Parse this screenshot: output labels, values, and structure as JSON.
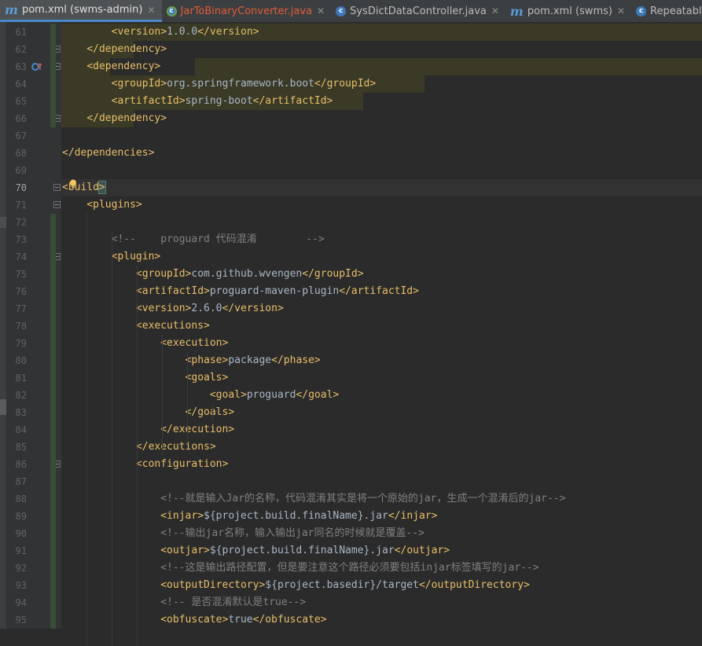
{
  "tabs": [
    {
      "icon": "maven-icon",
      "label": "pom.xml (swms-admin)",
      "active": true,
      "closable": true
    },
    {
      "icon": "java-class-icon",
      "label": "JarToBinaryConverter.java",
      "active": false,
      "closable": true,
      "error": true
    },
    {
      "icon": "java-class-icon",
      "label": "SysDictDataController.java",
      "active": false,
      "closable": true
    },
    {
      "icon": "maven-icon",
      "label": "pom.xml (swms)",
      "active": false,
      "closable": true
    },
    {
      "icon": "java-class-icon",
      "label": "RepeatableFilter.java",
      "active": false,
      "closable": false
    }
  ],
  "lines": [
    {
      "n": "61",
      "text": "        <version>1.0.0</version>"
    },
    {
      "n": "62",
      "text": "    </dependency>"
    },
    {
      "n": "63",
      "text": "    <dependency>"
    },
    {
      "n": "64",
      "text": "        <groupId>org.springframework.boot</groupId>"
    },
    {
      "n": "65",
      "text": "        <artifactId>spring-boot</artifactId>"
    },
    {
      "n": "66",
      "text": "    </dependency>"
    },
    {
      "n": "67",
      "text": ""
    },
    {
      "n": "68",
      "text": "</dependencies>"
    },
    {
      "n": "69",
      "text": ""
    },
    {
      "n": "70",
      "text": "<build>"
    },
    {
      "n": "71",
      "text": "    <plugins>"
    },
    {
      "n": "72",
      "text": ""
    },
    {
      "n": "73",
      "text": "        <!--    proguard 代码混淆        -->"
    },
    {
      "n": "74",
      "text": "        <plugin>"
    },
    {
      "n": "75",
      "text": "            <groupId>com.github.wvengen</groupId>"
    },
    {
      "n": "76",
      "text": "            <artifactId>proguard-maven-plugin</artifactId>"
    },
    {
      "n": "77",
      "text": "            <version>2.6.0</version>"
    },
    {
      "n": "78",
      "text": "            <executions>"
    },
    {
      "n": "79",
      "text": "                <execution>"
    },
    {
      "n": "80",
      "text": "                    <phase>package</phase>"
    },
    {
      "n": "81",
      "text": "                    <goals>"
    },
    {
      "n": "82",
      "text": "                        <goal>proguard</goal>"
    },
    {
      "n": "83",
      "text": "                    </goals>"
    },
    {
      "n": "84",
      "text": "                </execution>"
    },
    {
      "n": "85",
      "text": "            </executions>"
    },
    {
      "n": "86",
      "text": "            <configuration>"
    },
    {
      "n": "87",
      "text": ""
    },
    {
      "n": "88",
      "text": "                <!--就是输入Jar的名称，代码混淆其实是将一个原始的jar，生成一个混淆后的jar-->"
    },
    {
      "n": "89",
      "text": "                <injar>${project.build.finalName}.jar</injar>"
    },
    {
      "n": "90",
      "text": "                <!--输出jar名称，输入输出jar同名的时候就是覆盖-->"
    },
    {
      "n": "91",
      "text": "                <outjar>${project.build.finalName}.jar</outjar>"
    },
    {
      "n": "92",
      "text": "                <!--这是输出路径配置，但是要注意这个路径必须要包括injar标签填写的jar-->"
    },
    {
      "n": "93",
      "text": "                <outputDirectory>${project.basedir}/target</outputDirectory>"
    },
    {
      "n": "94",
      "text": "                <!-- 是否混淆默认是true-->"
    },
    {
      "n": "95",
      "text": "                <obfuscate>true</obfuscate>"
    }
  ],
  "current_line": "70",
  "colors": {
    "tag": "#e8bf6a",
    "text": "#a9b7c6",
    "comment": "#808080",
    "background": "#2b2b2b",
    "gutter": "#313335"
  }
}
